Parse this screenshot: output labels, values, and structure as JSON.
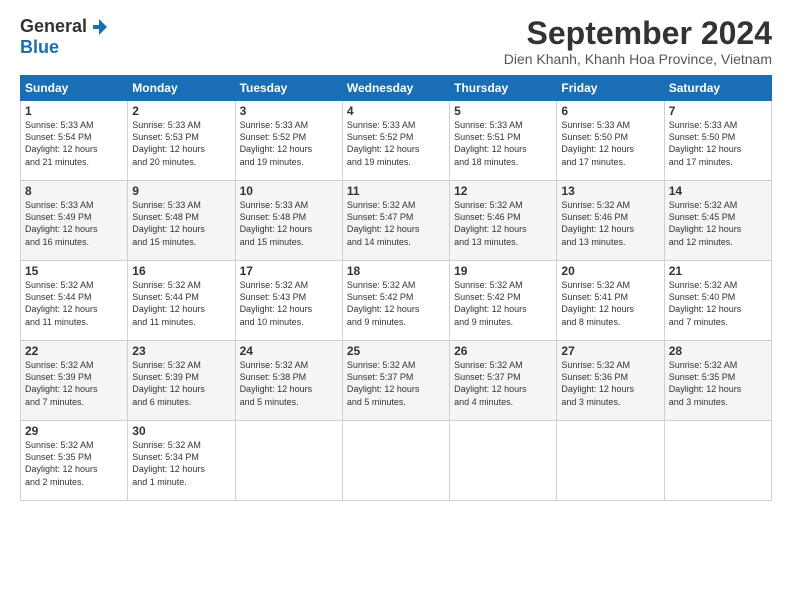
{
  "logo": {
    "general": "General",
    "blue": "Blue"
  },
  "title": "September 2024",
  "subtitle": "Dien Khanh, Khanh Hoa Province, Vietnam",
  "headers": [
    "Sunday",
    "Monday",
    "Tuesday",
    "Wednesday",
    "Thursday",
    "Friday",
    "Saturday"
  ],
  "weeks": [
    [
      {
        "day": "1",
        "info": "Sunrise: 5:33 AM\nSunset: 5:54 PM\nDaylight: 12 hours\nand 21 minutes."
      },
      {
        "day": "2",
        "info": "Sunrise: 5:33 AM\nSunset: 5:53 PM\nDaylight: 12 hours\nand 20 minutes."
      },
      {
        "day": "3",
        "info": "Sunrise: 5:33 AM\nSunset: 5:52 PM\nDaylight: 12 hours\nand 19 minutes."
      },
      {
        "day": "4",
        "info": "Sunrise: 5:33 AM\nSunset: 5:52 PM\nDaylight: 12 hours\nand 19 minutes."
      },
      {
        "day": "5",
        "info": "Sunrise: 5:33 AM\nSunset: 5:51 PM\nDaylight: 12 hours\nand 18 minutes."
      },
      {
        "day": "6",
        "info": "Sunrise: 5:33 AM\nSunset: 5:50 PM\nDaylight: 12 hours\nand 17 minutes."
      },
      {
        "day": "7",
        "info": "Sunrise: 5:33 AM\nSunset: 5:50 PM\nDaylight: 12 hours\nand 17 minutes."
      }
    ],
    [
      {
        "day": "8",
        "info": "Sunrise: 5:33 AM\nSunset: 5:49 PM\nDaylight: 12 hours\nand 16 minutes."
      },
      {
        "day": "9",
        "info": "Sunrise: 5:33 AM\nSunset: 5:48 PM\nDaylight: 12 hours\nand 15 minutes."
      },
      {
        "day": "10",
        "info": "Sunrise: 5:33 AM\nSunset: 5:48 PM\nDaylight: 12 hours\nand 15 minutes."
      },
      {
        "day": "11",
        "info": "Sunrise: 5:32 AM\nSunset: 5:47 PM\nDaylight: 12 hours\nand 14 minutes."
      },
      {
        "day": "12",
        "info": "Sunrise: 5:32 AM\nSunset: 5:46 PM\nDaylight: 12 hours\nand 13 minutes."
      },
      {
        "day": "13",
        "info": "Sunrise: 5:32 AM\nSunset: 5:46 PM\nDaylight: 12 hours\nand 13 minutes."
      },
      {
        "day": "14",
        "info": "Sunrise: 5:32 AM\nSunset: 5:45 PM\nDaylight: 12 hours\nand 12 minutes."
      }
    ],
    [
      {
        "day": "15",
        "info": "Sunrise: 5:32 AM\nSunset: 5:44 PM\nDaylight: 12 hours\nand 11 minutes."
      },
      {
        "day": "16",
        "info": "Sunrise: 5:32 AM\nSunset: 5:44 PM\nDaylight: 12 hours\nand 11 minutes."
      },
      {
        "day": "17",
        "info": "Sunrise: 5:32 AM\nSunset: 5:43 PM\nDaylight: 12 hours\nand 10 minutes."
      },
      {
        "day": "18",
        "info": "Sunrise: 5:32 AM\nSunset: 5:42 PM\nDaylight: 12 hours\nand 9 minutes."
      },
      {
        "day": "19",
        "info": "Sunrise: 5:32 AM\nSunset: 5:42 PM\nDaylight: 12 hours\nand 9 minutes."
      },
      {
        "day": "20",
        "info": "Sunrise: 5:32 AM\nSunset: 5:41 PM\nDaylight: 12 hours\nand 8 minutes."
      },
      {
        "day": "21",
        "info": "Sunrise: 5:32 AM\nSunset: 5:40 PM\nDaylight: 12 hours\nand 7 minutes."
      }
    ],
    [
      {
        "day": "22",
        "info": "Sunrise: 5:32 AM\nSunset: 5:39 PM\nDaylight: 12 hours\nand 7 minutes."
      },
      {
        "day": "23",
        "info": "Sunrise: 5:32 AM\nSunset: 5:39 PM\nDaylight: 12 hours\nand 6 minutes."
      },
      {
        "day": "24",
        "info": "Sunrise: 5:32 AM\nSunset: 5:38 PM\nDaylight: 12 hours\nand 5 minutes."
      },
      {
        "day": "25",
        "info": "Sunrise: 5:32 AM\nSunset: 5:37 PM\nDaylight: 12 hours\nand 5 minutes."
      },
      {
        "day": "26",
        "info": "Sunrise: 5:32 AM\nSunset: 5:37 PM\nDaylight: 12 hours\nand 4 minutes."
      },
      {
        "day": "27",
        "info": "Sunrise: 5:32 AM\nSunset: 5:36 PM\nDaylight: 12 hours\nand 3 minutes."
      },
      {
        "day": "28",
        "info": "Sunrise: 5:32 AM\nSunset: 5:35 PM\nDaylight: 12 hours\nand 3 minutes."
      }
    ],
    [
      {
        "day": "29",
        "info": "Sunrise: 5:32 AM\nSunset: 5:35 PM\nDaylight: 12 hours\nand 2 minutes."
      },
      {
        "day": "30",
        "info": "Sunrise: 5:32 AM\nSunset: 5:34 PM\nDaylight: 12 hours\nand 1 minute."
      },
      null,
      null,
      null,
      null,
      null
    ]
  ]
}
